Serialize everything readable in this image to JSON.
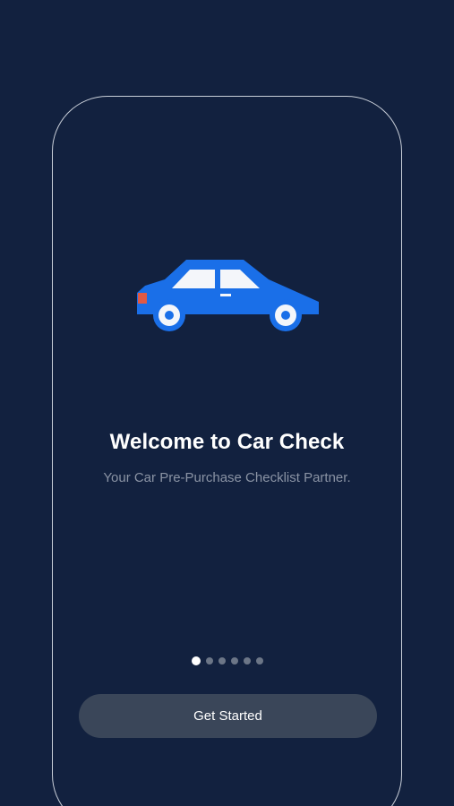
{
  "onboarding": {
    "illustration_icon": "car-icon",
    "title": "Welcome to Car Check",
    "subtitle": "Your Car Pre-Purchase Checklist Partner.",
    "pager": {
      "total_pages": 6,
      "active_page": 1
    },
    "primary_button_label": "Get Started"
  },
  "colors": {
    "background": "#12213f",
    "car_body": "#1a6fe8",
    "button_background": "#3a4659",
    "tail_light": "#e05a45"
  }
}
